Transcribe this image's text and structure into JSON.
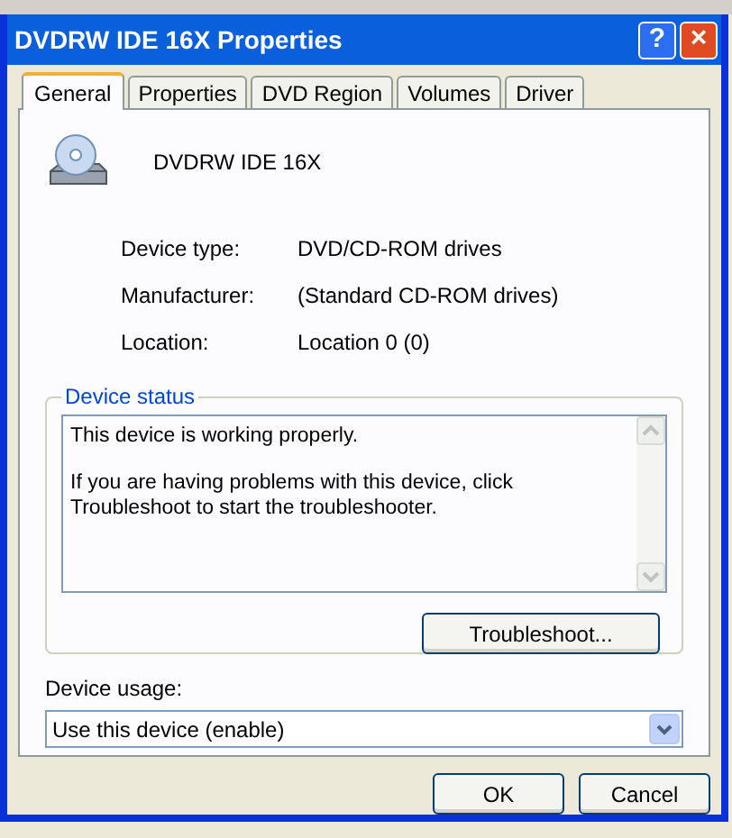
{
  "window": {
    "title": "DVDRW IDE 16X Properties"
  },
  "title_buttons": [
    {
      "kind": "help",
      "label": "?"
    },
    {
      "kind": "close",
      "label": "×"
    }
  ],
  "tabs": [
    {
      "label": "General",
      "selected": true
    },
    {
      "label": "Properties",
      "selected": false
    },
    {
      "label": "DVD Region",
      "selected": false
    },
    {
      "label": "Volumes",
      "selected": false
    },
    {
      "label": "Driver",
      "selected": false
    }
  ],
  "device": {
    "name": "DVDRW IDE 16X"
  },
  "properties": [
    {
      "label": "Device type:",
      "value": "DVD/CD-ROM drives"
    },
    {
      "label": "Manufacturer:",
      "value": "(Standard CD-ROM drives)"
    },
    {
      "label": "Location:",
      "value": "Location 0 (0)"
    }
  ],
  "device_status": {
    "title": "Device status",
    "paragraphs": [
      "This device is working properly.",
      "If you are having problems with this device, click Troubleshoot to start the troubleshooter."
    ],
    "button": "Troubleshoot..."
  },
  "device_usage": {
    "label": "Device usage:",
    "value": "Use this device (enable)"
  },
  "buttons": [
    "OK",
    "Cancel"
  ]
}
